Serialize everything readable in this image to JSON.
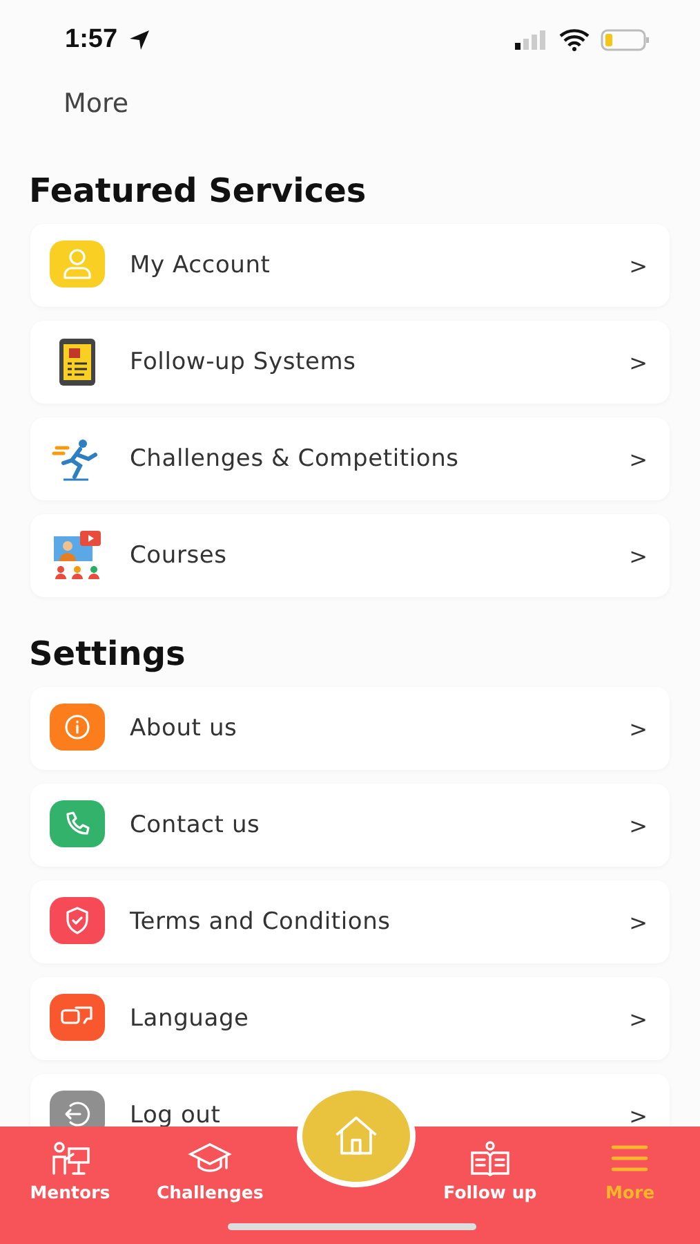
{
  "status_bar": {
    "time": "1:57"
  },
  "header": {
    "title": "More"
  },
  "sections": [
    {
      "title": "Featured Services",
      "items": [
        {
          "label": "My Account",
          "kind": "person",
          "color": "#f9cf24",
          "chevron": ">"
        },
        {
          "label": "Follow-up Systems",
          "kind": "tablet",
          "chevron": ">"
        },
        {
          "label": "Challenges & Competitions",
          "kind": "runner",
          "chevron": ">"
        },
        {
          "label": "Courses",
          "kind": "classroom",
          "chevron": ">"
        }
      ]
    },
    {
      "title": "Settings",
      "items": [
        {
          "label": "About us",
          "kind": "info",
          "color": "#fb7d1c",
          "chevron": ">"
        },
        {
          "label": "Contact us",
          "kind": "phone",
          "color": "#33b26b",
          "chevron": ">"
        },
        {
          "label": "Terms and Conditions",
          "kind": "shield",
          "color": "#f64b56",
          "chevron": ">"
        },
        {
          "label": "Language",
          "kind": "chat",
          "color": "#f9582f",
          "chevron": ">"
        },
        {
          "label": "Log out",
          "kind": "logout",
          "color": "#8f8f8f",
          "chevron": ">"
        }
      ]
    }
  ],
  "tab_bar": {
    "items": [
      {
        "label": "Mentors",
        "kind": "mentor",
        "selected": false
      },
      {
        "label": "Challenges",
        "kind": "cap",
        "selected": false
      },
      {
        "label": "Follow up",
        "kind": "book",
        "selected": false
      },
      {
        "label": "More",
        "kind": "menu",
        "selected": true
      }
    ]
  }
}
